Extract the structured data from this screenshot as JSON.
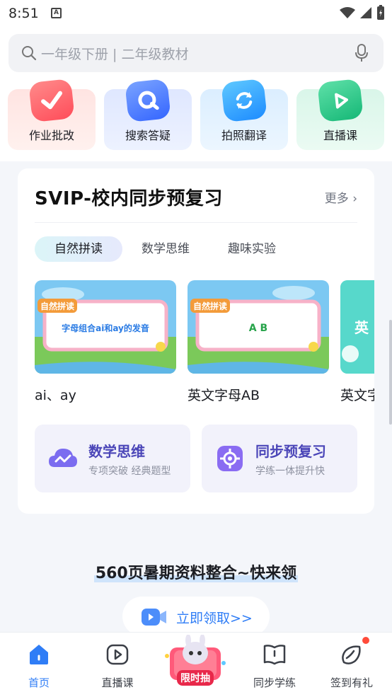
{
  "status_bar": {
    "time": "8:51"
  },
  "search": {
    "placeholder": "一年级下册 | 二年级教材"
  },
  "quick_actions": [
    {
      "label": "作业批改",
      "icon": "check-icon",
      "color": "#ff5a5f"
    },
    {
      "label": "搜索答疑",
      "icon": "search-q-icon",
      "color": "#3f7bff"
    },
    {
      "label": "拍照翻译",
      "icon": "translate-icon",
      "color": "#2fa8ff"
    },
    {
      "label": "直播课",
      "icon": "play-icon",
      "color": "#28c98a"
    }
  ],
  "svip_card": {
    "title": "SVIP-校内同步预复习",
    "more": "更多",
    "tabs": [
      "自然拼读",
      "数学思维",
      "趣味实验"
    ],
    "videos": [
      {
        "banner": "自然拼读",
        "text": "字母组合ai和ay的发音",
        "caption": "ai、ay"
      },
      {
        "banner": "自然拼读",
        "text": "A B",
        "caption": "英文字母AB"
      },
      {
        "banner": "",
        "text": "英",
        "caption": "英文字"
      }
    ],
    "features": [
      {
        "title": "数学思维",
        "subtitle": "专项突破 经典题型"
      },
      {
        "title": "同步预复习",
        "subtitle": "学练一体提升快"
      }
    ]
  },
  "promo": {
    "title": "560页暑期资料整合~快来领",
    "button": "立即领取>>"
  },
  "bottom_nav": [
    {
      "label": "首页",
      "icon": "home-icon",
      "active": true
    },
    {
      "label": "直播课",
      "icon": "live-icon",
      "active": false
    },
    {
      "label": "限时抽",
      "icon": "lottery-icon",
      "active": false
    },
    {
      "label": "同步学练",
      "icon": "book-icon",
      "active": false
    },
    {
      "label": "签到有礼",
      "icon": "checkin-icon",
      "active": false
    }
  ],
  "colors": {
    "accent": "#2f7df6",
    "feature_text": "#4b46b8"
  }
}
